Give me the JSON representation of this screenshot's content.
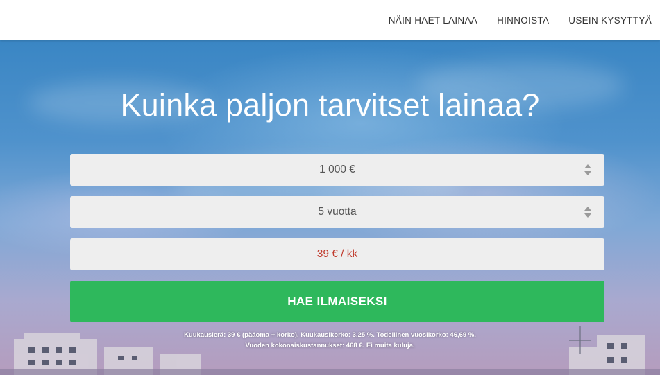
{
  "nav": {
    "items": [
      {
        "label": "NÄIN HAET LAINAA"
      },
      {
        "label": "HINNOISTA"
      },
      {
        "label": "USEIN KYSYTTYÄ"
      }
    ]
  },
  "hero": {
    "headline": "Kuinka paljon tarvitset lainaa?",
    "amount": {
      "value": "1 000 €",
      "icon": "up-down-arrows-icon"
    },
    "term": {
      "value": "5 vuotta",
      "icon": "up-down-arrows-icon"
    },
    "monthly": {
      "value": "39 € / kk"
    },
    "cta_label": "HAE ILMAISEKSI",
    "disclaimer_line1": "Kuukausierä: 39 € (pääoma + korko). Kuukausikorko: 3,25 %. Todellinen vuosikorko: 46,69 %.",
    "disclaimer_line2": "Vuoden kokonaiskustannukset: 468 €. Ei muita kuluja."
  },
  "colors": {
    "cta": "#2eb85c",
    "monthly_text": "#c0392b",
    "field_bg": "#eeeeee"
  }
}
